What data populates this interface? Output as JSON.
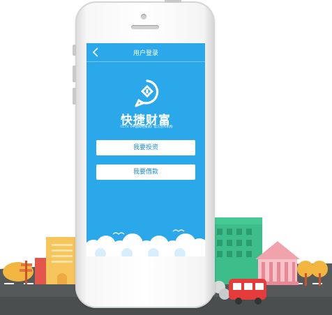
{
  "screen": {
    "nav_title": "用户登录",
    "brand_name": "快捷财富",
    "brand_tagline": "CCTV《中国财经报道》官方合作机构",
    "buttons": {
      "invest": "我要投资",
      "borrow": "我要借款"
    }
  },
  "colors": {
    "screen_bg": "#2aa8ea",
    "button_text": "#1e8fd6",
    "road": "#56595a",
    "building_green": "#3dbd89",
    "building_pink": "#f0a3ad",
    "bus_red": "#e63b3b",
    "sign_yellow": "#f6c55c"
  },
  "icons": [
    "back-arrow-icon",
    "logo-icon",
    "cloud-icon",
    "bird-icon"
  ]
}
